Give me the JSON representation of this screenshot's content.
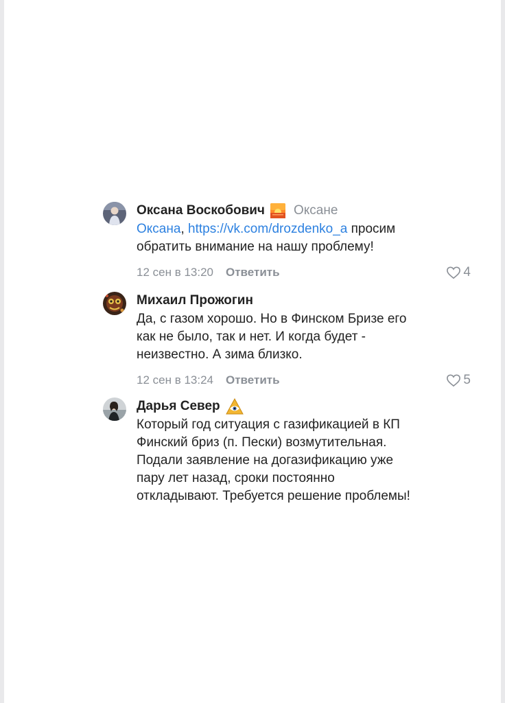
{
  "comments": [
    {
      "author": "Оксана Воскобович",
      "author_badge": "sunset-emoji-icon",
      "reply_to": "Оксане",
      "mention": "Оксана",
      "link": "https://vk.com/drozdenko_a",
      "text_line1_after": "просим",
      "text_line2": "обратить внимание на нашу проблему!",
      "date": "12 сен в 13:20",
      "reply_label": "Ответить",
      "likes": "4"
    },
    {
      "author": "Михаил Прожогин",
      "text_lines": [
        "Да, с газом хорошо. Но в Финском Бризе его",
        "как не было, так и нет. И когда будет -",
        "неизвестно. А зима близко."
      ],
      "date": "12 сен в 13:24",
      "reply_label": "Ответить",
      "likes": "5"
    },
    {
      "author": "Дарья Север",
      "author_badge": "eye-triangle-emoji-icon",
      "text_lines": [
        "Который год ситуация с газификацией в КП",
        "Финский бриз (п. Пески) возмутительная.",
        "Подали заявление на догазификацию уже",
        "пару лет назад, сроки постоянно",
        "откладывают. Требуется решение проблемы!"
      ]
    }
  ],
  "colors": {
    "link": "#2d81e0",
    "text": "#222222",
    "secondary": "#8a8f96",
    "background": "#ffffff"
  }
}
